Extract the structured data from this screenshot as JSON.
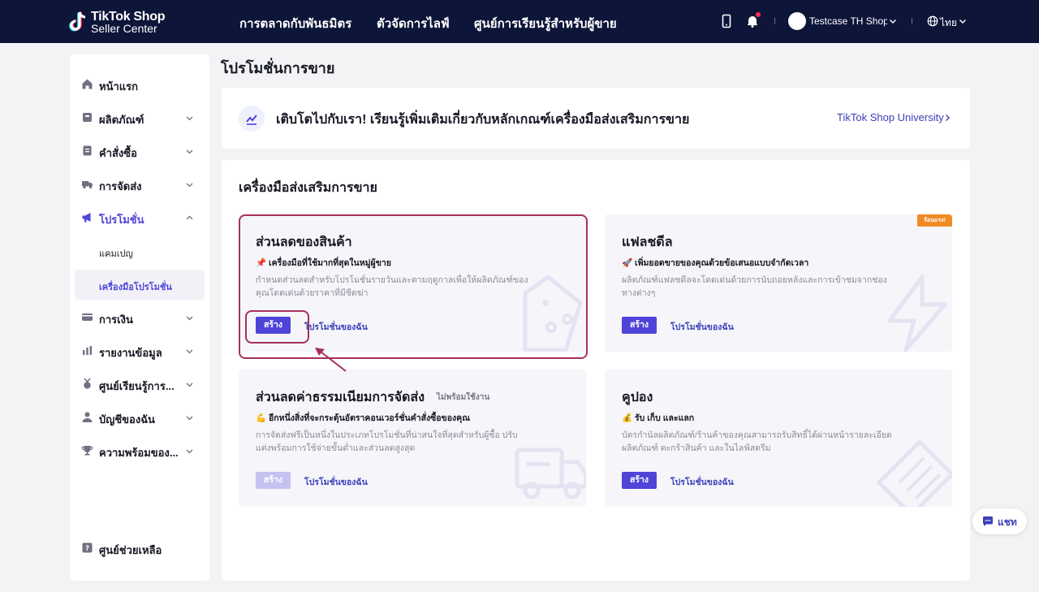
{
  "header": {
    "logo_line1": "TikTok Shop",
    "logo_line2": "Seller Center",
    "nav": [
      "การตลาดกับพันธมิตร",
      "ตัวจัดการไลฟ์",
      "ศูนย์การเรียนรู้สำหรับผู้ขาย"
    ],
    "shop_name": "Testcase TH Shop W",
    "language": "ไทย"
  },
  "sidebar": {
    "items": [
      {
        "label": "หน้าแรก",
        "icon": "home-icon"
      },
      {
        "label": "ผลิตภัณฑ์",
        "icon": "product-icon"
      },
      {
        "label": "คำสั่งซื้อ",
        "icon": "order-icon"
      },
      {
        "label": "การจัดส่ง",
        "icon": "truck-icon"
      },
      {
        "label": "โปรโมชั่น",
        "icon": "megaphone-icon"
      },
      {
        "label": "การเงิน",
        "icon": "card-icon"
      },
      {
        "label": "รายงานข้อมูล",
        "icon": "chart-icon"
      },
      {
        "label": "ศูนย์เรียนรู้การ...",
        "icon": "medal-icon"
      },
      {
        "label": "บัญชีของฉัน",
        "icon": "user-icon"
      },
      {
        "label": "ความพร้อมของ...",
        "icon": "trophy-icon"
      }
    ],
    "sub_items": [
      "แคมเปญ",
      "เครื่องมือโปรโมชั่น"
    ],
    "help_label": "ศูนย์ช่วยเหลือ"
  },
  "main": {
    "page_title": "โปรโมชั่นการขาย",
    "banner": {
      "text": "เติบโตไปกับเรา! เรียนรู้เพิ่มเติมเกี่ยวกับหลักเกณฑ์เครื่องมือส่งเสริมการขาย",
      "link": "TikTok Shop University"
    },
    "tools_title": "เครื่องมือส่งเสริมการขาย",
    "cards": [
      {
        "title": "ส่วนลดของสินค้า",
        "badge": "",
        "subtitle": "📌 เครื่องมือที่ใช้มากที่สุดในหมู่ผู้ขาย",
        "description": "กำหนดส่วนลดสำหรับโปรโมชั่นรายวันและตามฤดูกาลเพื่อให้ผลิตภัณฑ์ของคุณโดดเด่นด้วยราคาที่มีชีดฆ่า",
        "create_label": "สร้าง",
        "mine_label": "โปรโมชั่นของฉัน",
        "disabled": false
      },
      {
        "title": "แฟลชดีล",
        "badge": "",
        "hot": "ร้อนแรง!",
        "subtitle": "🚀 เพิ่มยอดขายของคุณด้วยข้อเสนอแบบจำกัดเวลา",
        "description": "ผลิตภัณฑ์แฟลชดีลจะโดดเด่นด้วยการนับถอยหลังและการเข้าชมจากช่องทางต่างๆ",
        "create_label": "สร้าง",
        "mine_label": "โปรโมชั่นของฉัน",
        "disabled": false
      },
      {
        "title": "ส่วนลดค่าธรรมเนียมการจัดส่ง",
        "badge": "ไม่พร้อมใช้งาน",
        "subtitle": "💪 อีกหนึ่งสิ่งที่จะกระตุ้นอัตราคอนเวอร์ชั่นคำสั่งซื้อของคุณ",
        "description": "การจัดส่งฟรีเป็นหนึ่งในประเภทโปรโมชั่นที่น่าสนใจที่สุดสำหรับผู้ซื้อ ปรับแต่งพร้อมการใช้จ่ายขั้นต่ำและส่วนลดสูงสุด",
        "create_label": "สร้าง",
        "mine_label": "โปรโมชั่นของฉัน",
        "disabled": true
      },
      {
        "title": "คูปอง",
        "badge": "",
        "subtitle": "💰 รับ เก็บ และแลก",
        "description": "บัตรกำนัลผลิตภัณฑ์/ร้านค้าของคุณสามารถรับสิทธิ์ได้ผ่านหน้ารายละเอียดผลิตภัณฑ์ ตะกร้าสินค้า และในไลฟ์สตรีม",
        "create_label": "สร้าง",
        "mine_label": "โปรโมชั่นของฉัน",
        "disabled": false
      }
    ]
  },
  "chat": {
    "label": "แชท"
  },
  "colors": {
    "nav_bg": "#0d1539",
    "accent": "#4e44d8",
    "highlight": "#a7305a",
    "hot": "#f08a24"
  }
}
